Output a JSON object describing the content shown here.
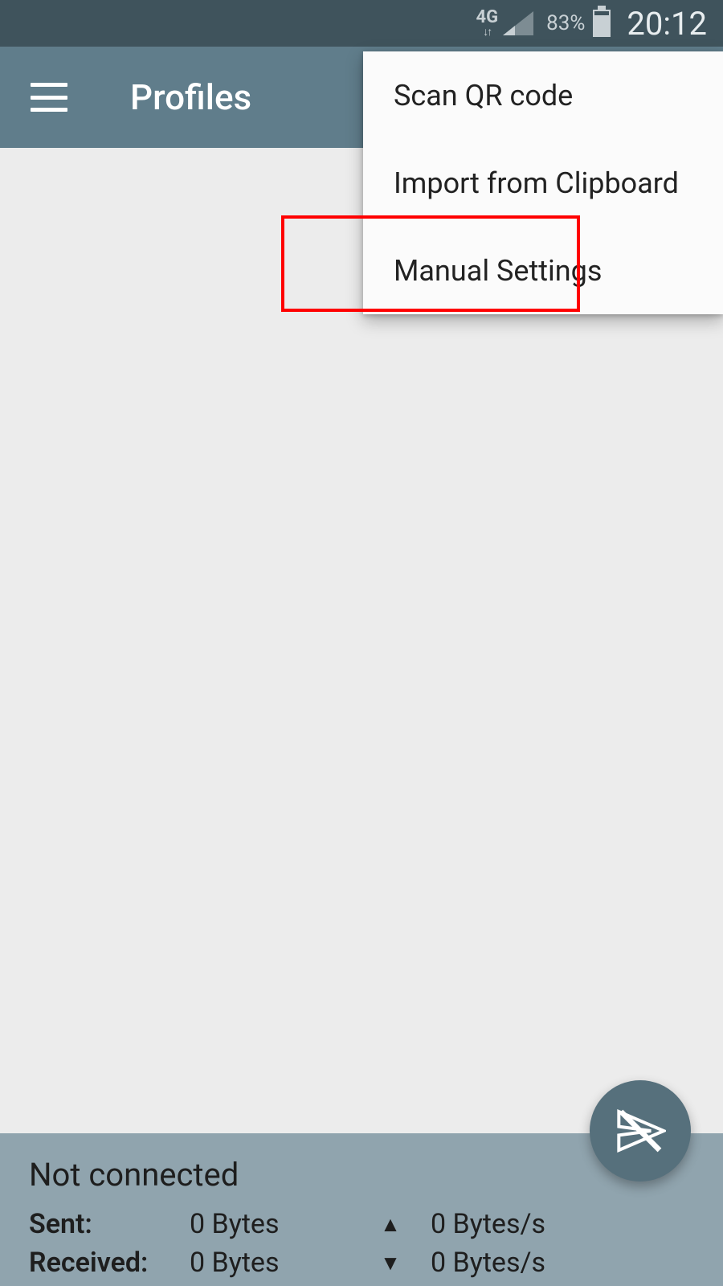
{
  "status_bar": {
    "network_label": "4G",
    "battery_pct": "83%",
    "time": "20:12"
  },
  "app_bar": {
    "title": "Profiles"
  },
  "menu": {
    "items": [
      {
        "label": "Scan QR code"
      },
      {
        "label": "Import from Clipboard"
      },
      {
        "label": "Manual Settings"
      }
    ]
  },
  "bottom": {
    "status": "Not connected",
    "sent_label": "Sent:",
    "sent_value": "0 Bytes",
    "sent_rate": "0 Bytes/s",
    "received_label": "Received:",
    "received_value": "0 Bytes",
    "received_rate": "0 Bytes/s",
    "up_arrow": "▲",
    "down_arrow": "▼"
  }
}
